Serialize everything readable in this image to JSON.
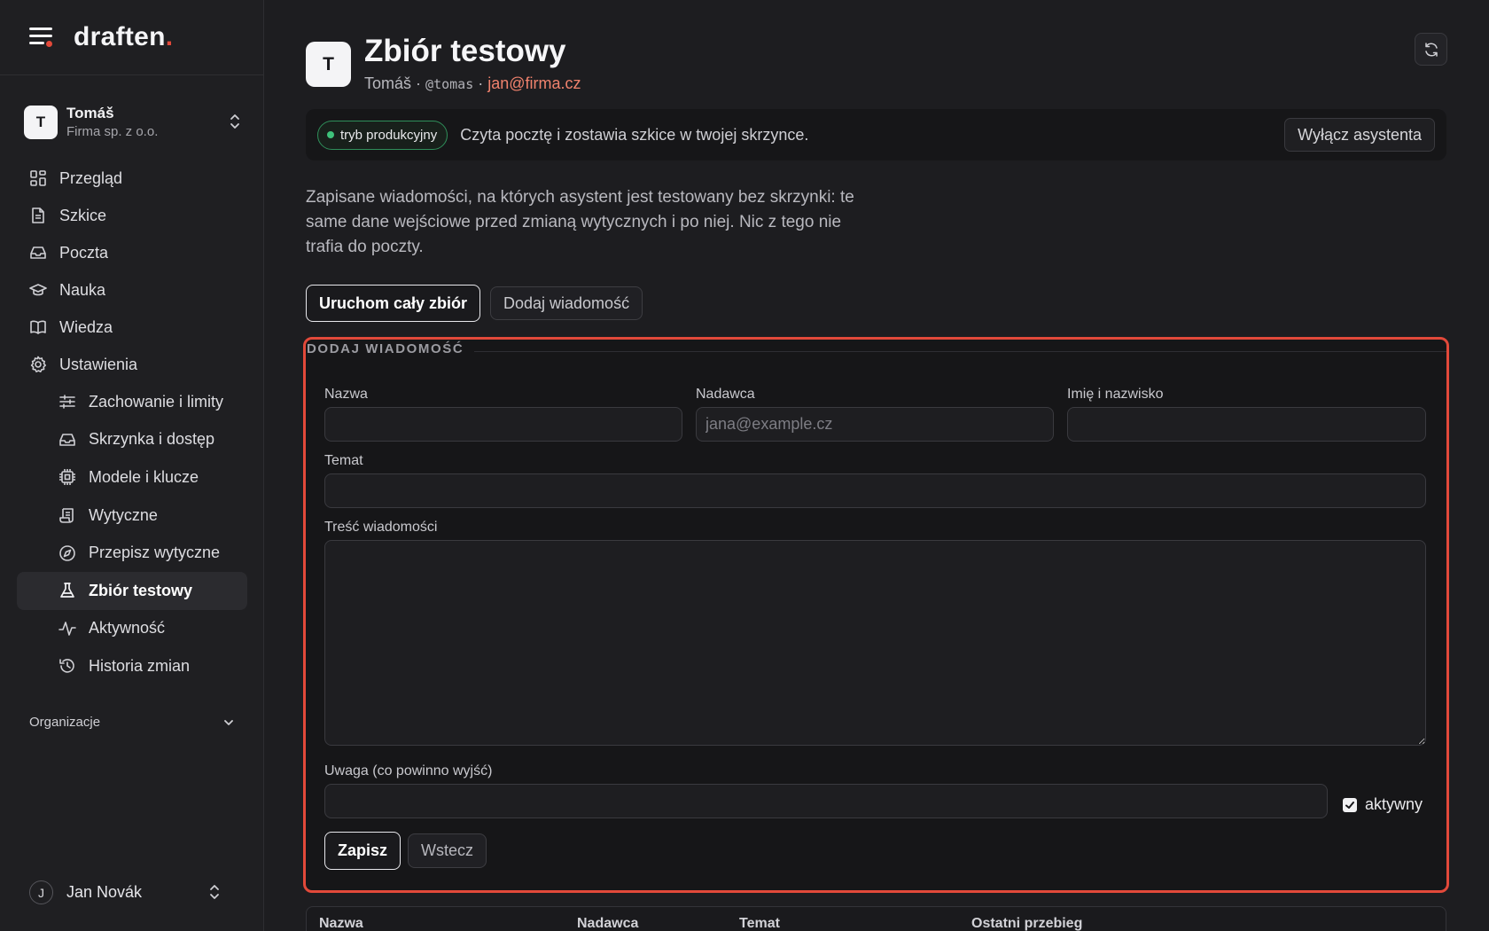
{
  "brand": {
    "name": "draften",
    "dot": "."
  },
  "account": {
    "initial": "T",
    "name": "Tomáš",
    "company": "Firma sp. z o.o."
  },
  "nav": {
    "items": [
      {
        "label": "Przegląd",
        "icon": "grid-icon"
      },
      {
        "label": "Szkice",
        "icon": "document-icon"
      },
      {
        "label": "Poczta",
        "icon": "inbox-icon"
      },
      {
        "label": "Nauka",
        "icon": "graduation-cap-icon"
      },
      {
        "label": "Wiedza",
        "icon": "book-icon"
      },
      {
        "label": "Ustawienia",
        "icon": "gear-icon"
      }
    ],
    "settings": [
      {
        "label": "Zachowanie i limity",
        "icon": "sliders-icon"
      },
      {
        "label": "Skrzynka i dostęp",
        "icon": "inbox-icon"
      },
      {
        "label": "Modele i klucze",
        "icon": "chip-icon"
      },
      {
        "label": "Wytyczne",
        "icon": "scroll-icon"
      },
      {
        "label": "Przepisz wytyczne",
        "icon": "compass-icon"
      },
      {
        "label": "Zbiór testowy",
        "icon": "flask-icon",
        "active": true
      },
      {
        "label": "Aktywność",
        "icon": "activity-icon"
      },
      {
        "label": "Historia zmian",
        "icon": "history-icon"
      }
    ]
  },
  "organizations": {
    "label": "Organizacje"
  },
  "user": {
    "initial": "J",
    "name": "Jan Novák"
  },
  "header": {
    "initial": "T",
    "title": "Zbiór testowy",
    "owner": "Tomáš",
    "sep": "·",
    "handle": "@tomas",
    "email": "jan@firma.cz"
  },
  "banner": {
    "mode": "tryb produkcyjny",
    "text": "Czyta pocztę i zostawia szkice w twojej skrzynce.",
    "button": "Wyłącz asystenta",
    "status_color": "#3ec27a"
  },
  "description": "Zapisane wiadomości, na których asystent jest testowany bez skrzynki: te same dane wejściowe przed zmianą wytycznych i po niej. Nic z tego nie trafia do poczty.",
  "actions": {
    "run_all": "Uruchom cały zbiór",
    "add_message": "Dodaj wiadomość"
  },
  "form": {
    "legend": "DODAJ WIADOMOŚĆ",
    "name_label": "Nazwa",
    "name_value": "",
    "sender_label": "Nadawca",
    "sender_placeholder": "jana@example.cz",
    "fullname_label": "Imię i nazwisko",
    "fullname_value": "",
    "subject_label": "Temat",
    "subject_value": "",
    "body_label": "Treść wiadomości",
    "body_value": "",
    "note_label": "Uwaga (co powinno wyjść)",
    "note_value": "",
    "active_label": "aktywny",
    "active_checked": true,
    "save": "Zapisz",
    "back": "Wstecz",
    "highlight_color": "#e2493a"
  },
  "table": {
    "columns": [
      "Nazwa",
      "Nadawca",
      "Temat",
      "Ostatni przebieg"
    ]
  }
}
